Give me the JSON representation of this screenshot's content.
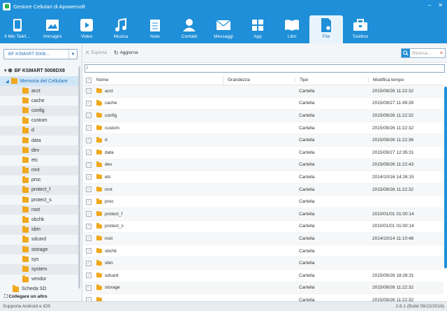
{
  "window": {
    "title": "Gestore Cellulari di Apowersoft",
    "controls": [
      "–",
      "✕"
    ]
  },
  "toolbar": [
    {
      "label": "Il Mio Telef…",
      "icon": "phone-icon"
    },
    {
      "label": "Immagini",
      "icon": "image-icon"
    },
    {
      "label": "Video",
      "icon": "video-icon"
    },
    {
      "label": "Musica",
      "icon": "music-icon"
    },
    {
      "label": "Note",
      "icon": "note-icon"
    },
    {
      "label": "Contatti",
      "icon": "contact-icon"
    },
    {
      "label": "Messaggi",
      "icon": "message-icon"
    },
    {
      "label": "App",
      "icon": "apps-icon"
    },
    {
      "label": "Libri",
      "icon": "book-icon"
    },
    {
      "label": "File",
      "icon": "file-icon",
      "active": true
    },
    {
      "label": "Toolbox",
      "icon": "toolbox-icon"
    }
  ],
  "sidebar": {
    "device_select": "BF KSMART 5008…",
    "device_name": "BF KSMART 5008DX8",
    "memory_label": "Memoria del Cellulare",
    "folders": [
      "acct",
      "cache",
      "config",
      "custom",
      "d",
      "data",
      "dev",
      "etc",
      "mnt",
      "proc",
      "protect_f",
      "protect_s",
      "root",
      "sbchk",
      "sbin",
      "sdcard",
      "storage",
      "sys",
      "system",
      "vendor"
    ],
    "sd_label": "Scheda SD",
    "connect_label": "Collegare un altro"
  },
  "actions": {
    "export_label": "Esporta",
    "refresh_label": "Aggiorna",
    "search_placeholder": "Ricerca..."
  },
  "path": "/",
  "table": {
    "headers": {
      "name": "Nome",
      "size": "Grandezza",
      "type": "Tipo",
      "date": "Modifica tempo"
    },
    "rows": [
      {
        "name": "acct",
        "type": "Cartella",
        "date": "2015/09/26 11:22:32"
      },
      {
        "name": "cache",
        "type": "Cartella",
        "date": "2015/09/27 11:49:39"
      },
      {
        "name": "config",
        "type": "Cartella",
        "date": "2015/09/26 11:22:32"
      },
      {
        "name": "custom",
        "type": "Cartella",
        "date": "2015/09/26 11:22:32"
      },
      {
        "name": "d",
        "type": "Cartella",
        "date": "2015/09/26 11:22:36"
      },
      {
        "name": "data",
        "type": "Cartella",
        "date": "2015/09/27 12:35:31"
      },
      {
        "name": "dev",
        "type": "Cartella",
        "date": "2015/09/26 11:22:43"
      },
      {
        "name": "etc",
        "type": "Cartella",
        "date": "2014/10/16 14:26:15"
      },
      {
        "name": "mnt",
        "type": "Cartella",
        "date": "2015/09/26 11:22:32"
      },
      {
        "name": "proc",
        "type": "Cartella",
        "date": ""
      },
      {
        "name": "protect_f",
        "type": "Cartella",
        "date": "2010/01/01 01:00:14"
      },
      {
        "name": "protect_s",
        "type": "Cartella",
        "date": "2010/01/01 01:00:14"
      },
      {
        "name": "root",
        "type": "Cartella",
        "date": "2014/10/14 11:10:48"
      },
      {
        "name": "sbchk",
        "type": "Cartella",
        "date": ""
      },
      {
        "name": "sbin",
        "type": "Cartella",
        "date": ""
      },
      {
        "name": "sdcard",
        "type": "Cartella",
        "date": "2015/09/26 18:26:31"
      },
      {
        "name": "storage",
        "type": "Cartella",
        "date": "2015/09/26 11:22:32"
      },
      {
        "name": "",
        "type": "Cartella",
        "date": "2015/09/26 11:22:32"
      }
    ]
  },
  "status": {
    "left": "Supporta Android e iOS",
    "right": "2.6.1 (Build 09/22/2016)"
  },
  "colors": {
    "accent": "#1e8fd8",
    "folder": "#f0a81c",
    "selected": "#cfe6f7"
  }
}
